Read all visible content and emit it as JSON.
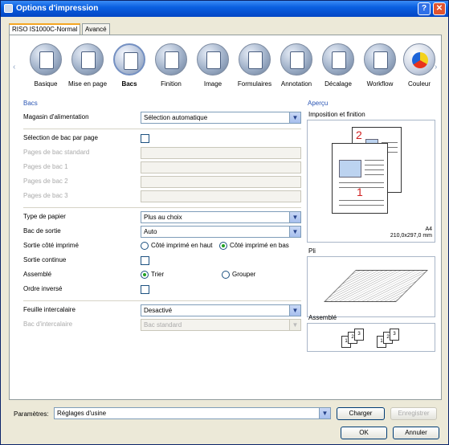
{
  "window": {
    "title": "Options d'impression"
  },
  "tabs": [
    "RISO IS1000C-Normal",
    "Avancé"
  ],
  "nav": {
    "items": [
      {
        "label": "Basique",
        "icon": "document-icon"
      },
      {
        "label": "Mise en page",
        "icon": "layout-icon"
      },
      {
        "label": "Bacs",
        "icon": "tray-icon",
        "active": true
      },
      {
        "label": "Finition",
        "icon": "finishing-icon"
      },
      {
        "label": "Image",
        "icon": "image-icon"
      },
      {
        "label": "Formulaires",
        "icon": "forms-icon"
      },
      {
        "label": "Annotation",
        "icon": "annotation-icon"
      },
      {
        "label": "Décalage",
        "icon": "offset-icon"
      },
      {
        "label": "Workflow",
        "icon": "workflow-icon"
      },
      {
        "label": "Couleur",
        "icon": "color-icon"
      }
    ]
  },
  "bacs": {
    "section_title": "Bacs",
    "magasin": {
      "label": "Magasin d'alimentation",
      "value": "Sélection automatique"
    },
    "selection_par_page": {
      "label": "Sélection de bac par page"
    },
    "pages_standard": {
      "label": "Pages de bac standard"
    },
    "pages_1": {
      "label": "Pages de bac 1"
    },
    "pages_2": {
      "label": "Pages de bac 2"
    },
    "pages_3": {
      "label": "Pages de bac 3"
    },
    "type_papier": {
      "label": "Type de papier",
      "value": "Plus au choix"
    },
    "bac_sortie": {
      "label": "Bac de sortie",
      "value": "Auto"
    },
    "sortie_cote": {
      "label": "Sortie côté imprimé",
      "option_up": "Côté imprimé en haut",
      "option_down": "Côté imprimé en bas"
    },
    "sortie_continue": {
      "label": "Sortie continue"
    },
    "assemble": {
      "label": "Assemblé",
      "option_trier": "Trier",
      "option_grouper": "Grouper"
    },
    "ordre_inverse": {
      "label": "Ordre inversé"
    },
    "feuille_intercalaire": {
      "label": "Feuille intercalaire",
      "value": "Desactivé"
    },
    "bac_intercalaire": {
      "label": "Bac d'intercalaire",
      "value": "Bac standard"
    }
  },
  "apercu": {
    "title": "Aperçu",
    "imposition_label": "Imposition et finition",
    "paper_size": "A4",
    "paper_dims": "210,0x297,0 mm",
    "pli_label": "Pli",
    "assemble_label": "Assemblé"
  },
  "bottom": {
    "parametres_label": "Paramètres:",
    "parametres_value": "Réglages d'usine",
    "charger": "Charger",
    "enregistrer": "Enregistrer",
    "ok": "OK",
    "annuler": "Annuler"
  }
}
